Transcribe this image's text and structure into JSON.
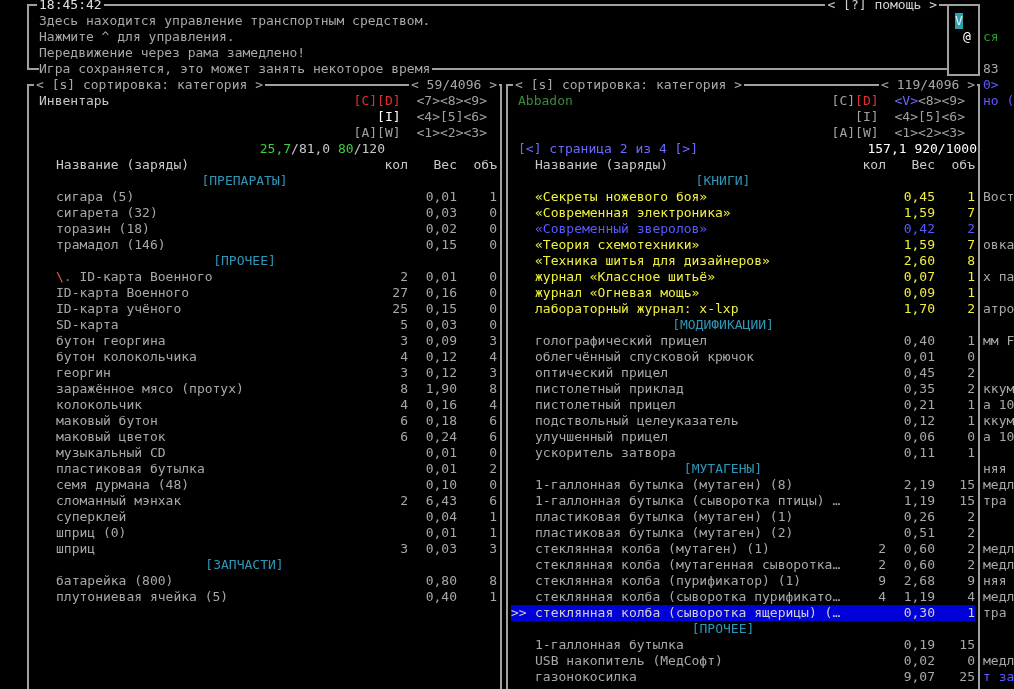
{
  "top_bar": {
    "clock": "18:45:42",
    "help": "< [?] помощь >"
  },
  "messages": [
    {
      "text": "Здесь находится управление транспортным средством."
    },
    {
      "text": "Нажмите ^ для управления.",
      "overflow": {
        "text": "ся",
        "color": "#2e9a2e"
      }
    },
    {
      "text": "Передвижение через рама замедлено!"
    },
    {
      "text": "Игра сохраняется, это может занять некоторое время",
      "overflow": {
        "text": "83",
        "color": "#a8a8a8"
      }
    }
  ],
  "minimap": {
    "rows": [
      [
        {
          "glyph": "V",
          "highlight": true
        }
      ],
      [
        null,
        {
          "glyph": "@",
          "highlight": false
        }
      ]
    ]
  },
  "panes": [
    {
      "kind": "inventory",
      "sort_label": "< [s] сортировка: категория >",
      "count": "< 59/4096 >",
      "title": "Инвентарь",
      "key_rows": [
        {
          "containers": [
            {
              "label": "[C]",
              "color": "#e03030"
            },
            {
              "label": "[D]",
              "color": "#e03030"
            }
          ],
          "directions": [
            {
              "label": "<7>",
              "color": "#a0a0a0"
            },
            {
              "label": "<8>",
              "color": "#a0a0a0"
            },
            {
              "label": "<9>",
              "color": "#a0a0a0"
            }
          ]
        },
        {
          "containers": [
            {
              "label": "[I]",
              "color": "#ffffff"
            }
          ],
          "directions": [
            {
              "label": "<4>",
              "color": "#a0a0a0"
            },
            {
              "label": "[5]",
              "color": "#a0a0a0"
            },
            {
              "label": "<6>",
              "color": "#a0a0a0"
            }
          ]
        },
        {
          "containers": [
            {
              "label": "[A]",
              "color": "#a0a0a0"
            },
            {
              "label": "[W]",
              "color": "#a0a0a0"
            }
          ],
          "directions": [
            {
              "label": "<1>",
              "color": "#a0a0a0"
            },
            {
              "label": "<2>",
              "color": "#a0a0a0"
            },
            {
              "label": "<3>",
              "color": "#a0a0a0"
            }
          ]
        }
      ],
      "weight": [
        {
          "text": "25,7",
          "color": "#44cc44"
        },
        {
          "text": "/81,0 ",
          "color": "#c8c8c8"
        },
        {
          "text": "80",
          "color": "#44cc44"
        },
        {
          "text": "/120",
          "color": "#c8c8c8"
        }
      ],
      "columns": [
        "Название (заряды)",
        "кол",
        "Вес",
        "объ"
      ],
      "rows": [
        {
          "kind": "category",
          "label": "[ПРЕПАРАТЫ]"
        },
        {
          "kind": "item",
          "name": "сигара (5)",
          "weight": "0,01",
          "volume": "1",
          "color": "#a8a8a8",
          "selected": false
        },
        {
          "kind": "item",
          "name": "сигарета (32)",
          "weight": "0,03",
          "volume": "0",
          "color": "#a8a8a8",
          "selected": false
        },
        {
          "kind": "item",
          "name": "торазин (18)",
          "weight": "0,02",
          "volume": "0",
          "color": "#a8a8a8",
          "selected": false
        },
        {
          "kind": "item",
          "name": "трамадол (146)",
          "weight": "0,15",
          "volume": "0",
          "color": "#a8a8a8",
          "selected": false
        },
        {
          "kind": "category",
          "label": "[ПРОЧЕЕ]"
        },
        {
          "kind": "item",
          "marker": "\\.",
          "name": "ID-карта Военного",
          "count": "2",
          "weight": "0,01",
          "volume": "0",
          "color": "#a8a8a8",
          "selected": false
        },
        {
          "kind": "item",
          "name": "ID-карта Военного",
          "count": "27",
          "weight": "0,16",
          "volume": "0",
          "color": "#a8a8a8",
          "selected": false
        },
        {
          "kind": "item",
          "name": "ID-карта учёного",
          "count": "25",
          "weight": "0,15",
          "volume": "0",
          "color": "#a8a8a8",
          "selected": false
        },
        {
          "kind": "item",
          "name": "SD-карта",
          "count": "5",
          "weight": "0,03",
          "volume": "0",
          "color": "#a8a8a8",
          "selected": false
        },
        {
          "kind": "item",
          "name": "бутон георгина",
          "count": "3",
          "weight": "0,09",
          "volume": "3",
          "color": "#a8a8a8",
          "selected": false
        },
        {
          "kind": "item",
          "name": "бутон колокольчика",
          "count": "4",
          "weight": "0,12",
          "volume": "4",
          "color": "#a8a8a8",
          "selected": false
        },
        {
          "kind": "item",
          "name": "георгин",
          "count": "3",
          "weight": "0,12",
          "volume": "3",
          "color": "#a8a8a8",
          "selected": false
        },
        {
          "kind": "item",
          "name": "заражённое мясо (протух)",
          "count": "8",
          "weight": "1,90",
          "volume": "8",
          "color": "#a8a8a8",
          "selected": false
        },
        {
          "kind": "item",
          "name": "колокольчик",
          "count": "4",
          "weight": "0,16",
          "volume": "4",
          "color": "#a8a8a8",
          "selected": false
        },
        {
          "kind": "item",
          "name": "маковый бутон",
          "count": "6",
          "weight": "0,18",
          "volume": "6",
          "color": "#a8a8a8",
          "selected": false
        },
        {
          "kind": "item",
          "name": "маковый цветок",
          "count": "6",
          "weight": "0,24",
          "volume": "6",
          "color": "#a8a8a8",
          "selected": false
        },
        {
          "kind": "item",
          "name": "музыкальный CD",
          "weight": "0,01",
          "volume": "0",
          "color": "#a8a8a8",
          "selected": false
        },
        {
          "kind": "item",
          "name": "пластиковая бутылка",
          "weight": "0,01",
          "volume": "2",
          "color": "#a8a8a8",
          "selected": false
        },
        {
          "kind": "item",
          "name": "семя дурмана (48)",
          "weight": "0,10",
          "volume": "0",
          "color": "#a8a8a8",
          "selected": false
        },
        {
          "kind": "item",
          "name": "сломанный мэнхак",
          "count": "2",
          "weight": "6,43",
          "volume": "6",
          "color": "#a8a8a8",
          "selected": false
        },
        {
          "kind": "item",
          "name": "суперклей",
          "weight": "0,04",
          "volume": "1",
          "color": "#a8a8a8",
          "selected": false
        },
        {
          "kind": "item",
          "name": "шприц (0)",
          "weight": "0,01",
          "volume": "1",
          "color": "#a8a8a8",
          "selected": false
        },
        {
          "kind": "item",
          "name": "шприц",
          "count": "3",
          "weight": "0,03",
          "volume": "3",
          "color": "#a8a8a8",
          "selected": false
        },
        {
          "kind": "category",
          "label": "[ЗАПЧАСТИ]"
        },
        {
          "kind": "item",
          "name": "батарейка (800)",
          "weight": "0,80",
          "volume": "8",
          "color": "#a8a8a8",
          "selected": false
        },
        {
          "kind": "item",
          "name": "плутониевая ячейка (5)",
          "weight": "0,40",
          "volume": "1",
          "color": "#a8a8a8",
          "selected": false
        }
      ]
    },
    {
      "kind": "vehicle",
      "sort_label": "< [s] сортировка: категория >",
      "count": "< 119/4096 >",
      "header_overflow": {
        "text": "0>",
        "color": "#5a5aff"
      },
      "title": "Abbadon",
      "title_overflow": {
        "text": "но (",
        "color": "#5a5aff"
      },
      "key_rows": [
        {
          "containers": [
            {
              "label": "[C]",
              "color": "#a0a0a0"
            },
            {
              "label": "[D]",
              "color": "#e03030"
            }
          ],
          "directions": [
            {
              "label": "<V>",
              "color": "#6a6aff"
            },
            {
              "label": "<8>",
              "color": "#a0a0a0"
            },
            {
              "label": "<9>",
              "color": "#a0a0a0"
            }
          ]
        },
        {
          "containers": [
            {
              "label": "[I]",
              "color": "#a0a0a0"
            }
          ],
          "directions": [
            {
              "label": "<4>",
              "color": "#a0a0a0"
            },
            {
              "label": "[5]",
              "color": "#a0a0a0"
            },
            {
              "label": "<6>",
              "color": "#a0a0a0"
            }
          ]
        },
        {
          "containers": [
            {
              "label": "[A]",
              "color": "#a0a0a0"
            },
            {
              "label": "[W]",
              "color": "#a0a0a0"
            }
          ],
          "directions": [
            {
              "label": "<1>",
              "color": "#a0a0a0"
            },
            {
              "label": "<2>",
              "color": "#a0a0a0"
            },
            {
              "label": "<3>",
              "color": "#a0a0a0"
            }
          ]
        }
      ],
      "page_nav": "[<] страница 2 из 4 [>]",
      "weight": [
        {
          "text": "157,1 920/1000",
          "color": "#ffffff"
        }
      ],
      "columns": [
        "Название (заряды)",
        "кол",
        "Вес",
        "объ"
      ],
      "rows": [
        {
          "kind": "category",
          "label": "[КНИГИ]"
        },
        {
          "kind": "item",
          "name": "«Секреты ножевого боя»",
          "weight": "0,45",
          "volume": "1",
          "color": "#f0f040",
          "selected": false,
          "overflow": {
            "text": "Вост",
            "color": "#a8a8a8"
          }
        },
        {
          "kind": "item",
          "name": "«Современная электроника»",
          "weight": "1,59",
          "volume": "7",
          "color": "#f0f040",
          "selected": false
        },
        {
          "kind": "item",
          "name": "«Современный зверолов»",
          "weight": "0,42",
          "volume": "2",
          "color": "#5a5aff",
          "selected": false
        },
        {
          "kind": "item",
          "name": "«Теория схемотехники»",
          "weight": "1,59",
          "volume": "7",
          "color": "#f0f040",
          "selected": false,
          "overflow": {
            "text": "овка",
            "color": "#a8a8a8"
          }
        },
        {
          "kind": "item",
          "name": "«Техника шитья для дизайнеров»",
          "weight": "2,60",
          "volume": "8",
          "color": "#f0f040",
          "selected": false
        },
        {
          "kind": "item",
          "name": "журнал «Классное шитьё»",
          "weight": "0,07",
          "volume": "1",
          "color": "#f0f040",
          "selected": false,
          "overflow": {
            "text": "х па",
            "color": "#a8a8a8"
          }
        },
        {
          "kind": "item",
          "name": "журнал «Огневая мощь»",
          "weight": "0,09",
          "volume": "1",
          "color": "#f0f040",
          "selected": false
        },
        {
          "kind": "item",
          "name": "лабораторный журнал: x-lxp",
          "weight": "1,70",
          "volume": "2",
          "color": "#f0f040",
          "selected": false,
          "overflow": {
            "text": "атро",
            "color": "#a8a8a8"
          }
        },
        {
          "kind": "category",
          "label": "[МОДИФИКАЦИИ]"
        },
        {
          "kind": "item",
          "name": "голографический прицел",
          "weight": "0,40",
          "volume": "1",
          "color": "#a8a8a8",
          "selected": false,
          "overflow": {
            "text": "мм F",
            "color": "#a8a8a8"
          }
        },
        {
          "kind": "item",
          "name": "облегчённый спусковой крючок",
          "weight": "0,01",
          "volume": "0",
          "color": "#a8a8a8",
          "selected": false
        },
        {
          "kind": "item",
          "name": "оптический прицел",
          "weight": "0,45",
          "volume": "2",
          "color": "#a8a8a8",
          "selected": false
        },
        {
          "kind": "item",
          "name": "пистолетный приклад",
          "weight": "0,35",
          "volume": "2",
          "color": "#a8a8a8",
          "selected": false,
          "overflow": {
            "text": "ккум",
            "color": "#a8a8a8"
          }
        },
        {
          "kind": "item",
          "name": "пистолетный прицел",
          "weight": "0,21",
          "volume": "1",
          "color": "#a8a8a8",
          "selected": false,
          "overflow": {
            "text": "а 10",
            "color": "#a8a8a8"
          }
        },
        {
          "kind": "item",
          "name": "подствольный целеуказатель",
          "weight": "0,12",
          "volume": "1",
          "color": "#a8a8a8",
          "selected": false,
          "overflow": {
            "text": "ккум",
            "color": "#a8a8a8"
          }
        },
        {
          "kind": "item",
          "name": "улучшенный прицел",
          "weight": "0,06",
          "volume": "0",
          "color": "#a8a8a8",
          "selected": false,
          "overflow": {
            "text": "а 10",
            "color": "#a8a8a8"
          }
        },
        {
          "kind": "item",
          "name": "ускоритель затвора",
          "weight": "0,11",
          "volume": "1",
          "color": "#a8a8a8",
          "selected": false
        },
        {
          "kind": "category",
          "label": "[МУТАГЕНЫ]",
          "overflow": {
            "text": "няя",
            "color": "#a8a8a8"
          }
        },
        {
          "kind": "item",
          "name": "1-галлонная бутылка (мутаген) (8)",
          "weight": "2,19",
          "volume": "15",
          "color": "#a8a8a8",
          "selected": false,
          "overflow": {
            "text": "медл",
            "color": "#a8a8a8"
          }
        },
        {
          "kind": "item",
          "name": "1-галлонная бутылка (сыворотка птицы) …",
          "weight": "1,19",
          "volume": "15",
          "color": "#a8a8a8",
          "selected": false,
          "overflow": {
            "text": "тра",
            "color": "#a8a8a8"
          }
        },
        {
          "kind": "item",
          "name": "пластиковая бутылка (мутаген) (1)",
          "weight": "0,26",
          "volume": "2",
          "color": "#a8a8a8",
          "selected": false
        },
        {
          "kind": "item",
          "name": "пластиковая бутылка (мутаген) (2)",
          "weight": "0,51",
          "volume": "2",
          "color": "#a8a8a8",
          "selected": false
        },
        {
          "kind": "item",
          "name": "стеклянная колба (мутаген) (1)",
          "count": "2",
          "weight": "0,60",
          "volume": "2",
          "color": "#a8a8a8",
          "selected": false,
          "overflow": {
            "text": "медл",
            "color": "#a8a8a8"
          }
        },
        {
          "kind": "item",
          "name": "стеклянная колба (мутагенная сыворотка…",
          "count": "2",
          "weight": "0,60",
          "volume": "2",
          "color": "#a8a8a8",
          "selected": false,
          "overflow": {
            "text": "медл",
            "color": "#a8a8a8"
          }
        },
        {
          "kind": "item",
          "name": "стеклянная колба (пурификатор) (1)",
          "count": "9",
          "weight": "2,68",
          "volume": "9",
          "color": "#a8a8a8",
          "selected": false,
          "overflow": {
            "text": "няя",
            "color": "#a8a8a8"
          }
        },
        {
          "kind": "item",
          "name": "стеклянная колба (сыворотка пурификато…",
          "count": "4",
          "weight": "1,19",
          "volume": "4",
          "color": "#a8a8a8",
          "selected": false,
          "overflow": {
            "text": "медл",
            "color": "#a8a8a8"
          }
        },
        {
          "kind": "item",
          "cursor": ">>",
          "name": "стеклянная колба (сыворотка ящерицы) (…",
          "weight": "0,30",
          "volume": "1",
          "selected": true,
          "overflow": {
            "text": "тра",
            "color": "#a8a8a8"
          }
        },
        {
          "kind": "category",
          "label": "[ПРОЧЕЕ]"
        },
        {
          "kind": "item",
          "name": "1-галлонная бутылка",
          "weight": "0,19",
          "volume": "15",
          "color": "#a8a8a8",
          "selected": false
        },
        {
          "kind": "item",
          "name": "USB накопитель (МедСофт)",
          "weight": "0,02",
          "volume": "0",
          "color": "#a8a8a8",
          "selected": false,
          "overflow": {
            "text": "медл",
            "color": "#a8a8a8"
          }
        },
        {
          "kind": "item",
          "name": "газонокосилка",
          "weight": "9,07",
          "volume": "25",
          "color": "#a8a8a8",
          "selected": false,
          "overflow": {
            "text": "т за",
            "color": "#5a5aff"
          }
        }
      ]
    }
  ]
}
